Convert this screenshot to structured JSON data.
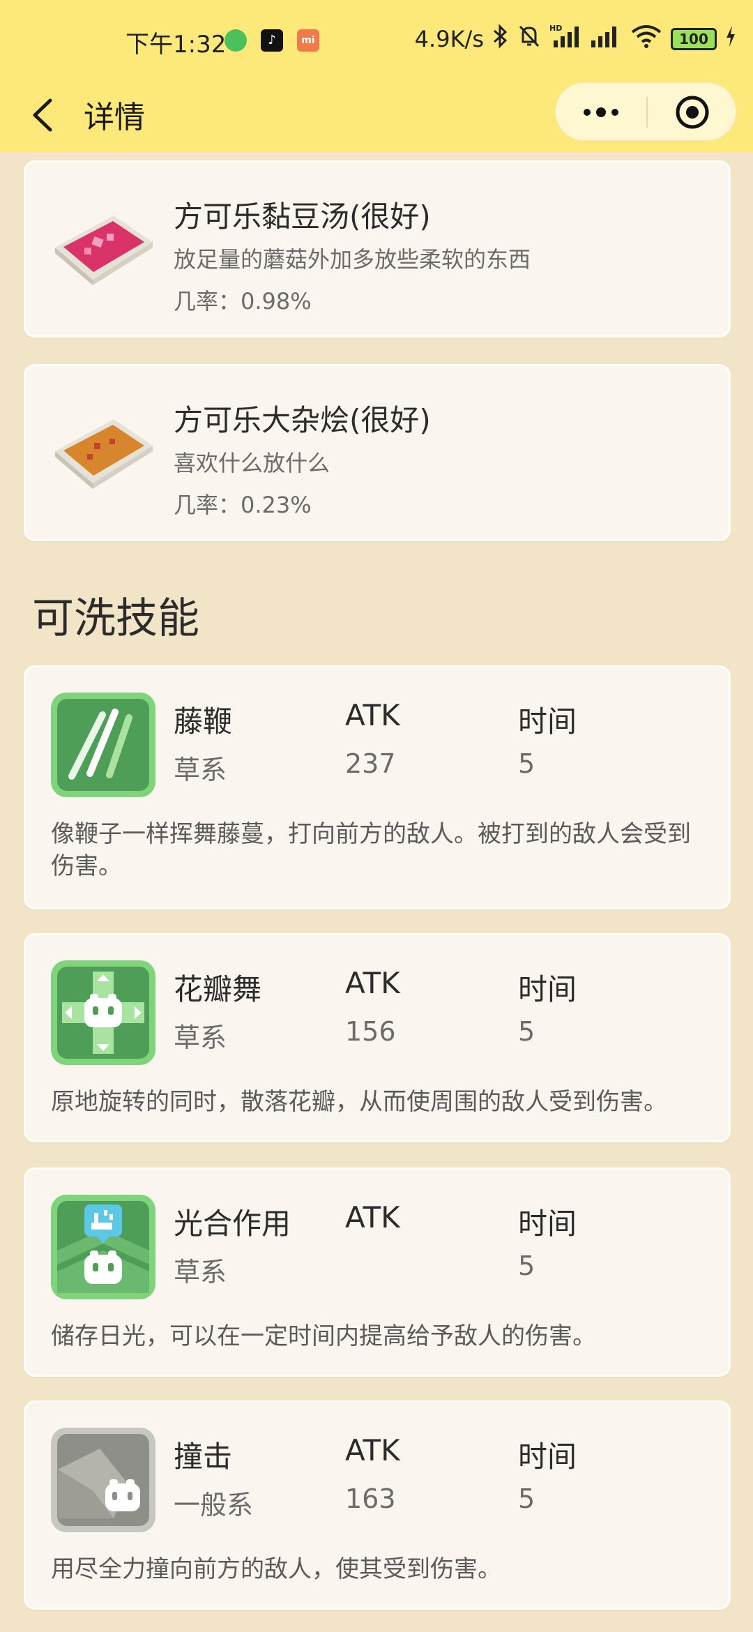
{
  "status_bar": {
    "time": "下午1:32",
    "net_speed": "4.9K/s",
    "battery": "100"
  },
  "nav": {
    "title": "详情"
  },
  "foods": [
    {
      "name": "方可乐黏豆汤(很好)",
      "desc": "放足量的蘑菇外加多放些柔软的东西",
      "rate": "几率：0.98%"
    },
    {
      "name": "方可乐大杂烩(很好)",
      "desc": "喜欢什么放什么",
      "rate": "几率：0.23%"
    }
  ],
  "section_title": "可洗技能",
  "skills": [
    {
      "name": "藤鞭",
      "type": "草系",
      "atk_label": "ATK",
      "atk": "237",
      "time_label": "时间",
      "time": "5",
      "desc": "像鞭子一样挥舞藤蔓，打向前方的敌人。被打到的敌人会受到伤害。",
      "icon": "vine-whip-icon"
    },
    {
      "name": "花瓣舞",
      "type": "草系",
      "atk_label": "ATK",
      "atk": "156",
      "time_label": "时间",
      "time": "5",
      "desc": "原地旋转的同时，散落花瓣，从而使周围的敌人受到伤害。",
      "icon": "petal-dance-icon"
    },
    {
      "name": "光合作用",
      "type": "草系",
      "atk_label": "ATK",
      "atk": "",
      "time_label": "时间",
      "time": "5",
      "desc": "储存日光，可以在一定时间内提高给予敌人的伤害。",
      "icon": "photosynthesis-icon"
    },
    {
      "name": "撞击",
      "type": "一般系",
      "atk_label": "ATK",
      "atk": "163",
      "time_label": "时间",
      "time": "5",
      "desc": "用尽全力撞向前方的敌人，使其受到伤害。",
      "icon": "tackle-icon"
    }
  ],
  "colors": {
    "header_bg": "#fde97a",
    "page_bg": "#f2e4c6",
    "card_bg": "#faf6ef",
    "grass_icon": "#5fb866",
    "normal_icon": "#a9a9a4"
  }
}
